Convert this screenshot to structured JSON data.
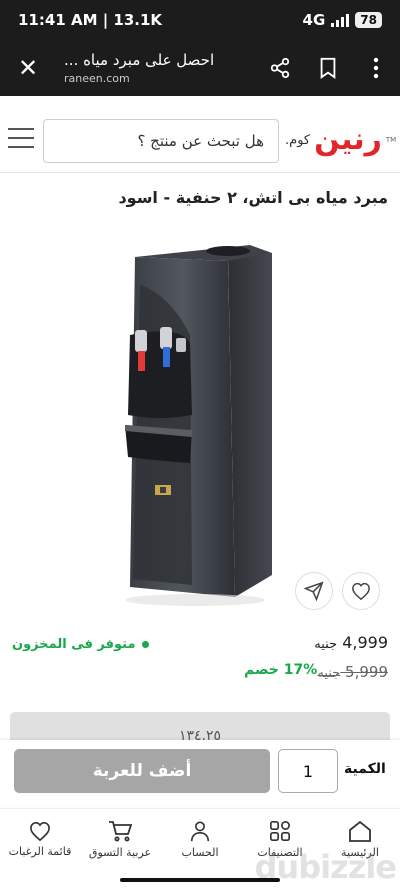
{
  "status_bar": {
    "time": "11:41 AM | 13.1K",
    "network": "4G",
    "battery": "78"
  },
  "browser": {
    "page_title": "احصل على مبرد مياه ...",
    "url": "raneen.com"
  },
  "header": {
    "logo_brand": "رنين",
    "logo_domain": ".كوم",
    "logo_tm": "TM",
    "search_placeholder": "هل تبحث عن منتج ؟"
  },
  "product": {
    "title": "مبرد مياه بى اتش، ٢ حنفية - اسود",
    "stock_status": "متوفر فى المخزون",
    "price": "4,999",
    "currency": "جنيه",
    "old_price": "5,999",
    "discount": "17% خصم",
    "partial_bar_text": "١٣٤.٢٥"
  },
  "cart": {
    "add_label": "أضف للعربة",
    "quantity": "1",
    "quantity_label": "الكمية"
  },
  "bottom_nav": {
    "home": "الرئيسية",
    "categories": "التصنيفات",
    "account": "الحساب",
    "cart": "عربية التسوق",
    "wishlist": "قائمة الرغبات"
  },
  "watermark": "dubizzle",
  "colors": {
    "brand_red": "#e0262b",
    "stock_green": "#1aa84e",
    "button_gray": "#a6a6a6",
    "dark_bar": "#1c1c1c"
  }
}
